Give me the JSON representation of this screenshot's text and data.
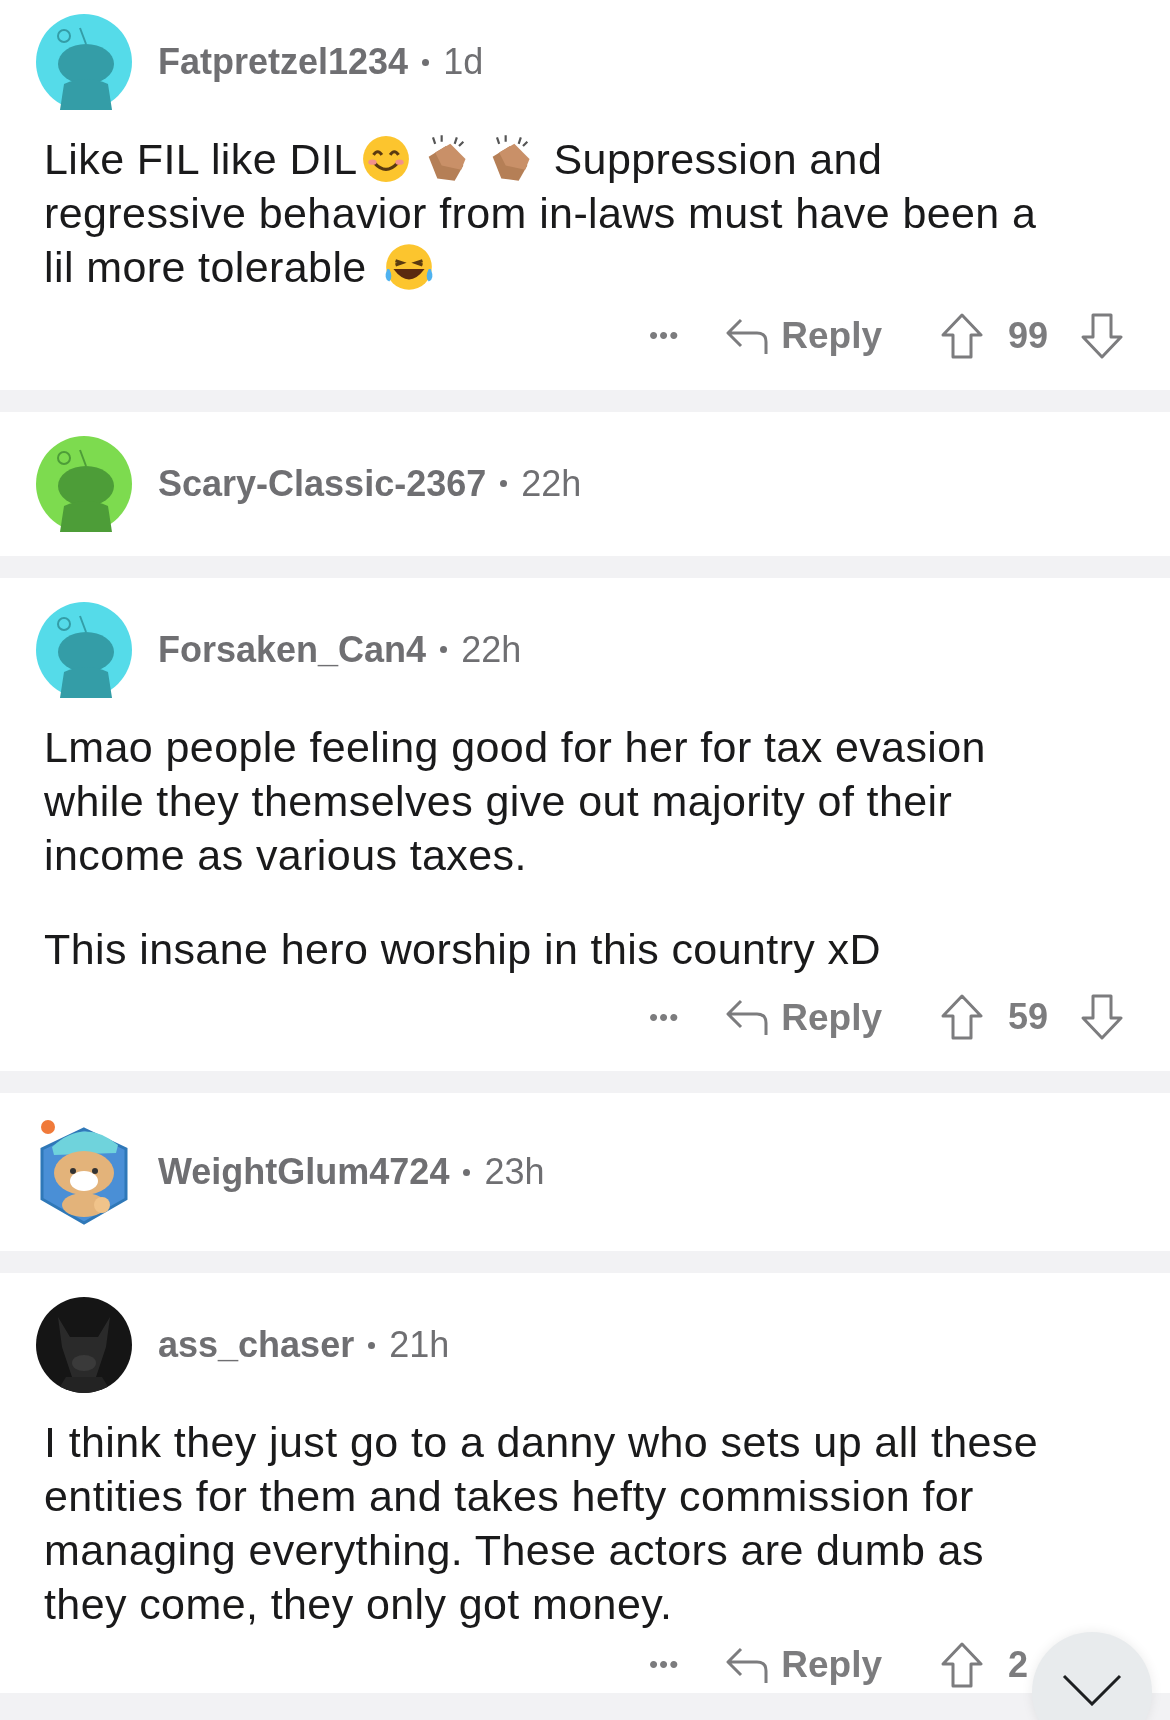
{
  "comments": [
    {
      "avatar": {
        "kind": "snoo",
        "color": "#55dbe9"
      },
      "username": "Fatpretzel1234",
      "age": "1d",
      "body": [
        [
          [
            {
              "kind": "text",
              "text": "Like FIL like DIL"
            },
            {
              "kind": "smile"
            },
            {
              "kind": "clap"
            },
            {
              "kind": "clap"
            },
            {
              "kind": "text",
              "text": "Suppression and"
            }
          ],
          [
            {
              "kind": "text",
              "text": "regressive behavior from in-laws must have been a"
            }
          ],
          [
            {
              "kind": "text",
              "text": "lil more tolerable"
            },
            {
              "kind": "laugh"
            }
          ]
        ]
      ],
      "actions": {
        "more": "•••",
        "reply": "Reply",
        "votes": "99"
      }
    },
    {
      "avatar": {
        "kind": "snoo",
        "color": "#7ddb4f"
      },
      "username": "Scary-Classic-2367",
      "age": "22h"
    },
    {
      "avatar": {
        "kind": "snoo",
        "color": "#55dbe9"
      },
      "username": "Forsaken_Can4",
      "age": "22h",
      "body": [
        [
          [
            {
              "kind": "text",
              "text": "Lmao people feeling good for her for tax evasion"
            }
          ],
          [
            {
              "kind": "text",
              "text": "while they themselves give out majority of their"
            }
          ],
          [
            {
              "kind": "text",
              "text": "income as various taxes."
            }
          ]
        ],
        [
          [
            {
              "kind": "text",
              "text": "This insane hero worship in this country xD"
            }
          ]
        ]
      ],
      "actions": {
        "more": "•••",
        "reply": "Reply",
        "votes": "59"
      }
    },
    {
      "avatar": {
        "kind": "sticker"
      },
      "username": "WeightGlum4724",
      "age": "23h"
    },
    {
      "avatar": {
        "kind": "picture"
      },
      "username": "ass_chaser",
      "age": "21h",
      "body": [
        [
          [
            {
              "kind": "text",
              "text": "I think they just go to a danny who sets up all these"
            }
          ],
          [
            {
              "kind": "text",
              "text": "entities for them and takes hefty commission for"
            }
          ],
          [
            {
              "kind": "text",
              "text": "managing everything. These actors are dumb as"
            }
          ],
          [
            {
              "kind": "text",
              "text": "they come, they only got money."
            }
          ]
        ]
      ],
      "actions": {
        "more": "•••",
        "reply": "Reply",
        "votes": "2"
      }
    }
  ],
  "scroll_button": {
    "kind": "chevron"
  }
}
